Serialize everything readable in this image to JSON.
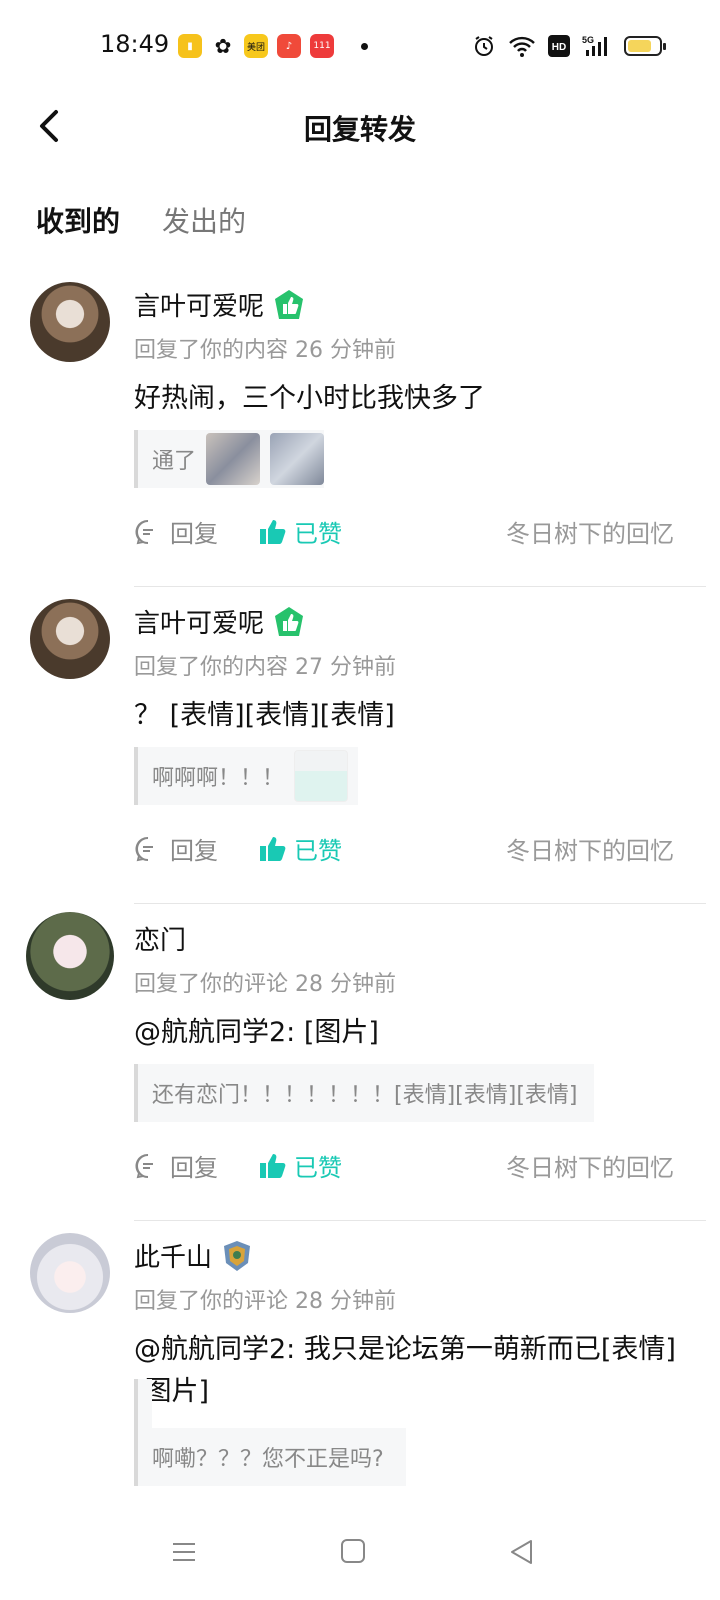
{
  "status_bar": {
    "time": "18:49",
    "app_badge_meituan": "美团",
    "app_badge_taobao": "111"
  },
  "header": {
    "title": "回复转发"
  },
  "tabs": [
    {
      "label": "收到的"
    },
    {
      "label": "发出的"
    }
  ],
  "action_labels": {
    "reply": "回复",
    "liked": "已赞"
  },
  "items": [
    {
      "username": "言叶可爱呢",
      "meta": "回复了你的内容 26 分钟前",
      "content": "好热闹，三个小时比我快多了",
      "quote": "通了",
      "origin": "冬日树下的回忆"
    },
    {
      "username": "言叶可爱呢",
      "meta": "回复了你的内容 27 分钟前",
      "content": "？ [表情][表情][表情]",
      "quote": "啊啊啊！！！",
      "origin": "冬日树下的回忆"
    },
    {
      "username": "恋门",
      "meta": "回复了你的评论 28 分钟前",
      "content": "@航航同学2: [图片]",
      "quote": "还有恋门！！！！！！！[表情][表情][表情]",
      "origin": "冬日树下的回忆"
    },
    {
      "username": "此千山",
      "meta": "回复了你的评论 28 分钟前",
      "content": "@航航同学2: 我只是论坛第一萌新而已[表情][图片]",
      "quote": "啊嘞？？？您不正是吗?"
    }
  ],
  "colors": {
    "accent": "#19c9b4",
    "badge_green": "#27c26c"
  }
}
